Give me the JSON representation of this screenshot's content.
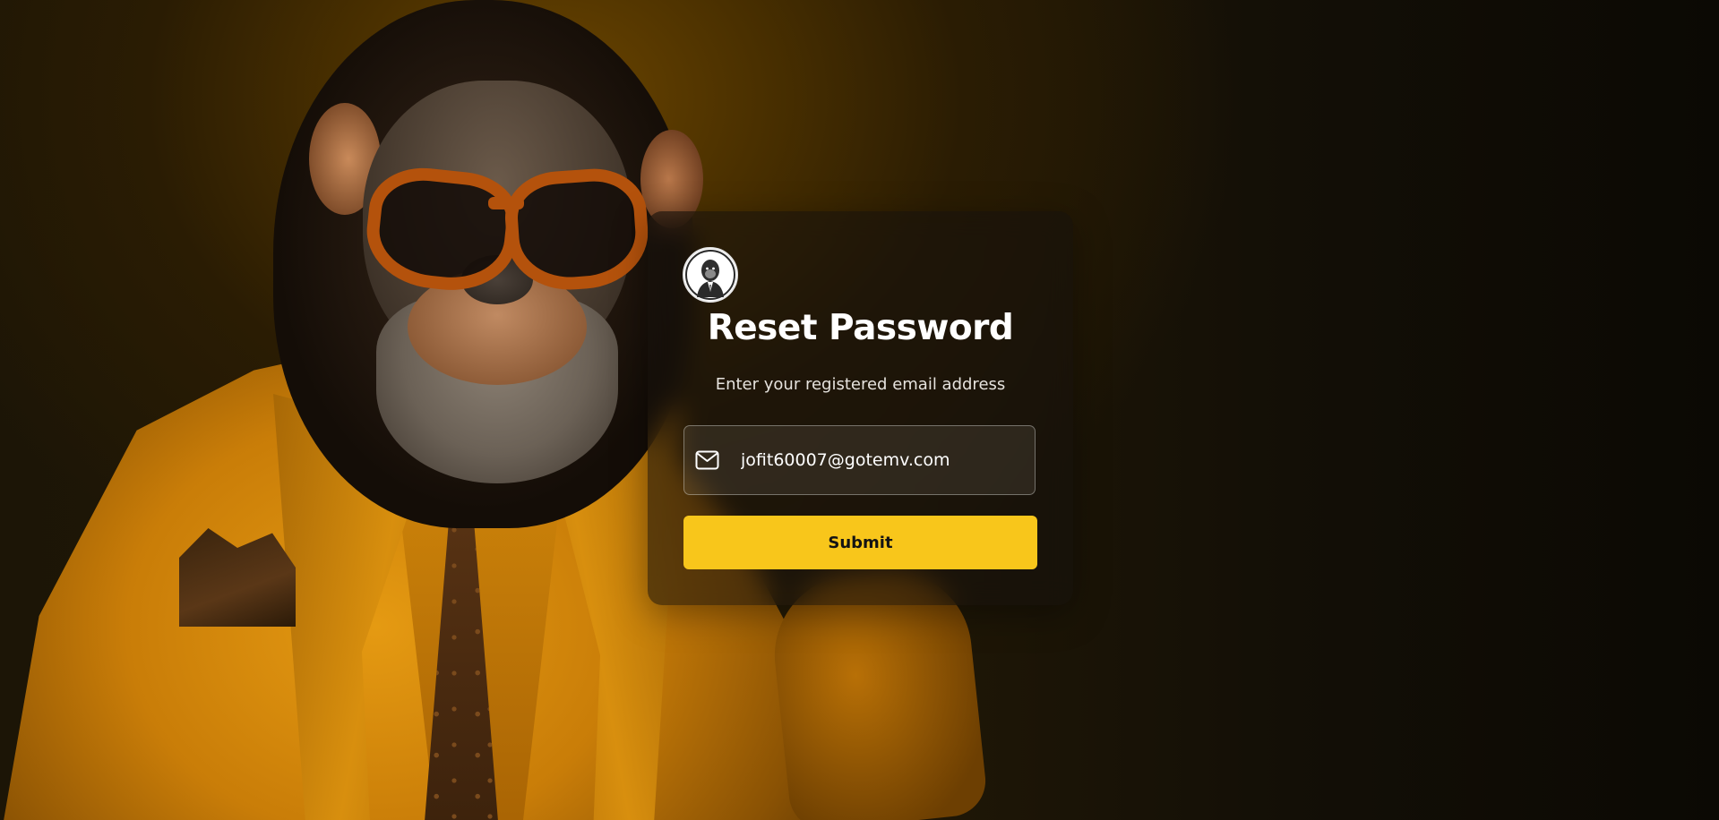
{
  "page": {
    "background_icon": "suited-chimpanzee-illustration",
    "accent_color": "#f8c61b"
  },
  "card": {
    "logo_icon": "gorilla-in-suit-logo",
    "title": "Reset Password",
    "subtitle": "Enter your registered email address",
    "email": {
      "icon": "mail-icon",
      "value": "jofit60007@gotemv.com",
      "placeholder": ""
    },
    "submit_label": "Submit"
  }
}
